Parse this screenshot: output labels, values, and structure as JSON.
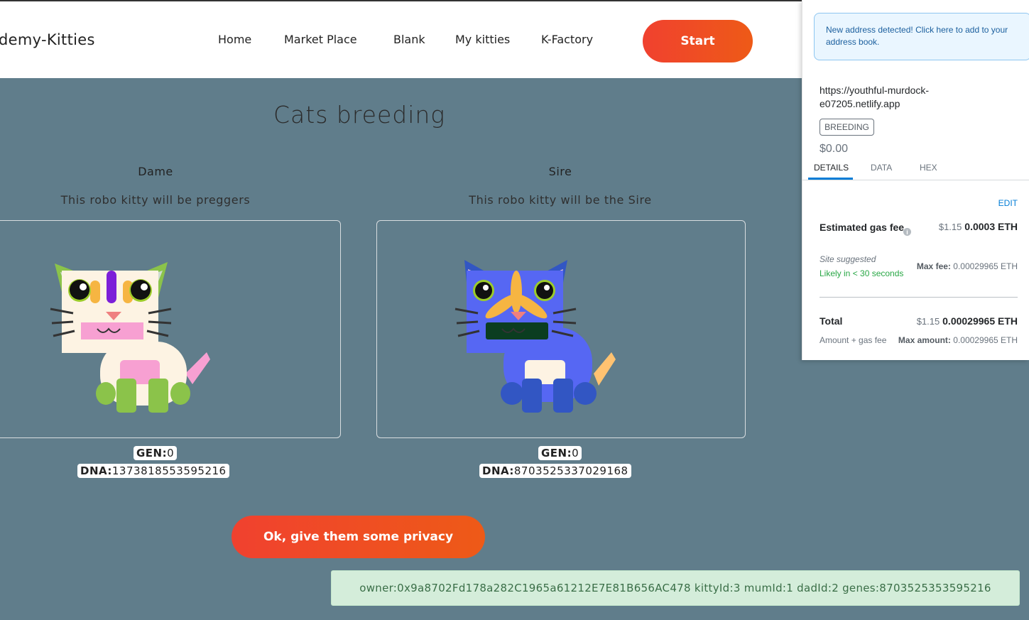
{
  "nav": {
    "brand": "demy-Kitties",
    "items": [
      "Home",
      "Market Place",
      "Blank",
      "My kitties",
      "K-Factory"
    ],
    "start_label": "Start"
  },
  "main": {
    "title": "Cats breeding",
    "dame": {
      "title": "Dame",
      "subtitle": "This robo kitty will be preggers",
      "gen_label": "GEN:",
      "gen": "0",
      "dna_label": "DNA:",
      "dna": "1373818553595216"
    },
    "sire": {
      "title": "Sire",
      "subtitle": "This robo kitty will be the Sire",
      "gen_label": "GEN:",
      "gen": "0",
      "dna_label": "DNA:",
      "dna": "8703525337029168"
    },
    "privacy_button": "Ok, give them some privacy",
    "toast": "owner:0x9a8702Fd178a282C1965a61212E7E81B656AC478 kittyId:3 mumId:1 dadId:2 genes:8703525353595216"
  },
  "metamask": {
    "alert": "New address detected! Click here to add to your address book.",
    "origin": "https://youthful-murdock-e07205.netlify.app",
    "method_tag": "BREEDING",
    "amount": "$0.00",
    "tabs": [
      "DETAILS",
      "DATA",
      "HEX"
    ],
    "edit": "EDIT",
    "gas_label": "Estimated gas fee",
    "gas_usd": "$1.15",
    "gas_eth": "0.0003 ETH",
    "site_suggested": "Site suggested",
    "likely": "Likely in < 30 seconds",
    "max_fee_label": "Max fee:",
    "max_fee": "0.00029965 ETH",
    "total_label": "Total",
    "total_usd": "$1.15",
    "total_eth": "0.00029965 ETH",
    "amount_plus_gas": "Amount + gas fee",
    "max_amount_label": "Max amount:",
    "max_amount": "0.00029965 ETH"
  },
  "colors": {
    "background": "#607d8b",
    "button_gradient_start": "#f0412f",
    "button_gradient_end": "#ee5a17",
    "toast_bg": "#d4edda",
    "mm_link": "#037dd6",
    "mm_success": "#28a745"
  }
}
